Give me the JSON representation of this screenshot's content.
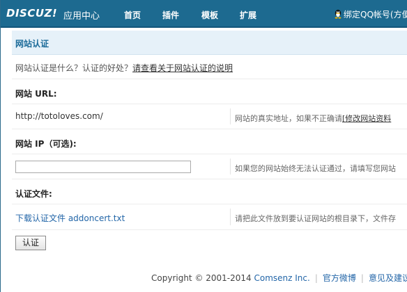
{
  "topbar": {
    "logo": "DISCUZ!",
    "logo_sub": "应用中心",
    "nav": [
      "首页",
      "插件",
      "模板",
      "扩展"
    ],
    "qq_link": "绑定QQ帐号(方便"
  },
  "main": {
    "section_title": "网站认证",
    "intro_text": "网站认证是什么？认证的好处？",
    "intro_link": "请查看关于网站认证的说明",
    "url_label": "网站 URL:",
    "url_value": "http://totoloves.com/",
    "url_desc": "网站的真实地址，如果不正确请",
    "url_desc_link": "[修改网站资料",
    "ip_label": "网站 IP（可选):",
    "ip_value": "",
    "ip_desc": "如果您的网站始终无法认证通过，请填写您网站",
    "file_label": "认证文件:",
    "file_link": "下载认证文件 addoncert.txt",
    "file_desc": "请把此文件放到要认证网站的根目录下，文件存",
    "submit_label": "认证"
  },
  "footer": {
    "copyright": "Copyright © 2001-2014",
    "company": "Comsenz Inc.",
    "weibo": "官方微博",
    "feedback": "意见及建议反"
  },
  "colors": {
    "topbar": "#1d6a90",
    "section_bg": "#e6f1f9",
    "link": "#2366a8"
  }
}
